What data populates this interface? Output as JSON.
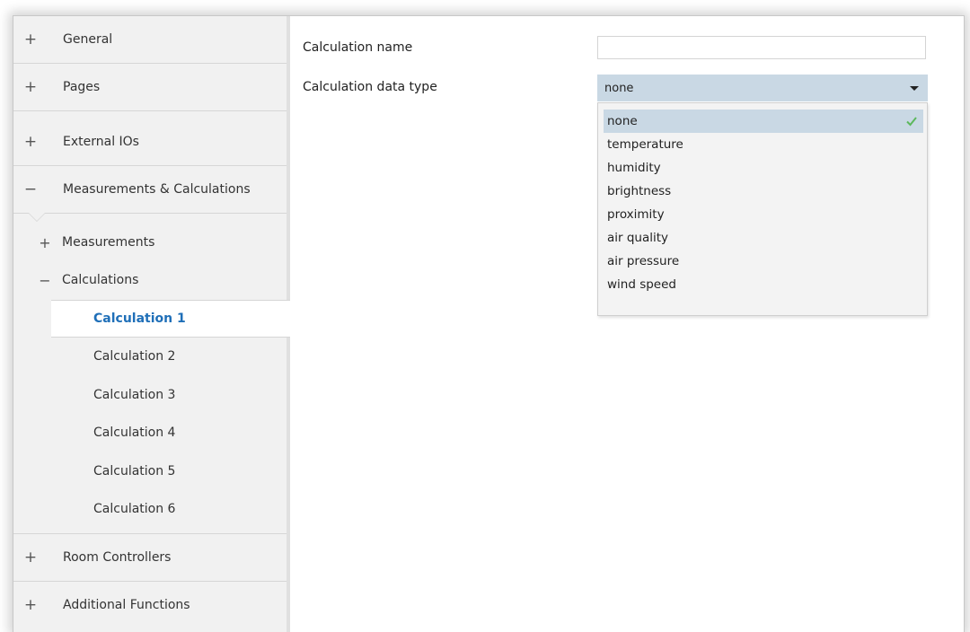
{
  "sidebar": {
    "groups": [
      {
        "sign": "+",
        "label": "General"
      },
      {
        "sign": "+",
        "label": "Pages"
      },
      {
        "sign": "+",
        "label": "External IOs"
      },
      {
        "sign": "−",
        "label": "Measurements & Calculations"
      },
      {
        "sign": "+",
        "label": "Room Controllers"
      },
      {
        "sign": "+",
        "label": "Additional Functions"
      }
    ],
    "subgroups": [
      {
        "sign": "+",
        "label": "Measurements"
      },
      {
        "sign": "−",
        "label": "Calculations"
      }
    ],
    "calculations": [
      "Calculation 1",
      "Calculation 2",
      "Calculation 3",
      "Calculation 4",
      "Calculation 5",
      "Calculation 6"
    ],
    "active_calculation": "Calculation 1"
  },
  "main": {
    "name_label": "Calculation name",
    "name_value": "",
    "type_label": "Calculation data type",
    "type_value": "none",
    "options": [
      "none",
      "temperature",
      "humidity",
      "brightness",
      "proximity",
      "air quality",
      "air pressure",
      "wind speed"
    ],
    "selected_option": "none"
  },
  "colors": {
    "accent_text": "#1f6fb8",
    "selection_bg": "#c9d8e4",
    "check": "#5cb85c"
  }
}
